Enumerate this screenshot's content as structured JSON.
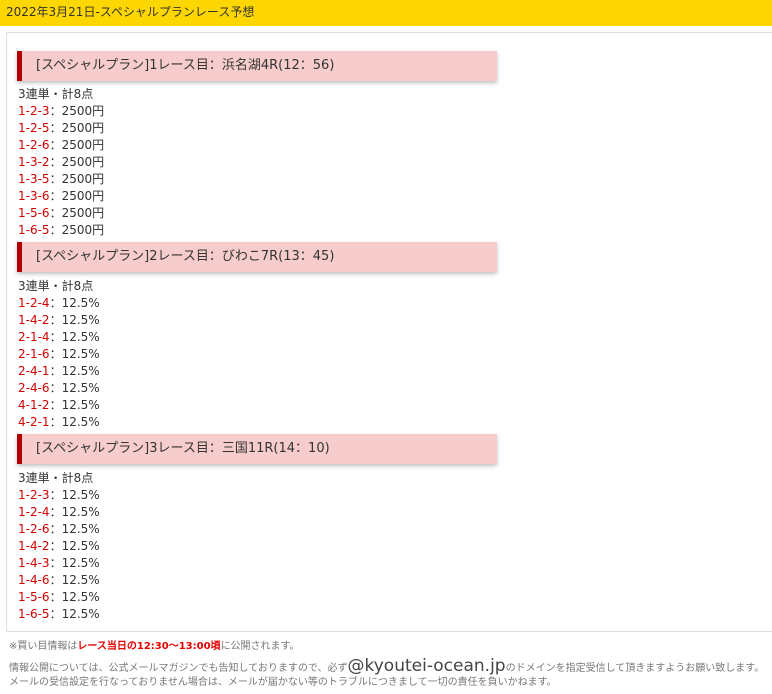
{
  "title": "2022年3月21日-スペシャルプランレース予想",
  "races": [
    {
      "heading": "[スペシャルプラン]1レース目：浜名湖4R(12：56)",
      "summary": "3連単・計8点",
      "bets": [
        {
          "combo": "1-2-3",
          "amount": "：2500円"
        },
        {
          "combo": "1-2-5",
          "amount": "：2500円"
        },
        {
          "combo": "1-2-6",
          "amount": "：2500円"
        },
        {
          "combo": "1-3-2",
          "amount": "：2500円"
        },
        {
          "combo": "1-3-5",
          "amount": "：2500円"
        },
        {
          "combo": "1-3-6",
          "amount": "：2500円"
        },
        {
          "combo": "1-5-6",
          "amount": "：2500円"
        },
        {
          "combo": "1-6-5",
          "amount": "：2500円"
        }
      ]
    },
    {
      "heading": "[スペシャルプラン]2レース目：びわこ7R(13：45)",
      "summary": "3連単・計8点",
      "bets": [
        {
          "combo": "1-2-4",
          "amount": "：12.5%"
        },
        {
          "combo": "1-4-2",
          "amount": "：12.5%"
        },
        {
          "combo": "2-1-4",
          "amount": "：12.5%"
        },
        {
          "combo": "2-1-6",
          "amount": "：12.5%"
        },
        {
          "combo": "2-4-1",
          "amount": "：12.5%"
        },
        {
          "combo": "2-4-6",
          "amount": "：12.5%"
        },
        {
          "combo": "4-1-2",
          "amount": "：12.5%"
        },
        {
          "combo": "4-2-1",
          "amount": "：12.5%"
        }
      ]
    },
    {
      "heading": "[スペシャルプラン]3レース目：三国11R(14：10)",
      "summary": "3連単・計8点",
      "bets": [
        {
          "combo": "1-2-3",
          "amount": "：12.5%"
        },
        {
          "combo": "1-2-4",
          "amount": "：12.5%"
        },
        {
          "combo": "1-2-6",
          "amount": "：12.5%"
        },
        {
          "combo": "1-4-2",
          "amount": "：12.5%"
        },
        {
          "combo": "1-4-3",
          "amount": "：12.5%"
        },
        {
          "combo": "1-4-6",
          "amount": "：12.5%"
        },
        {
          "combo": "1-5-6",
          "amount": "：12.5%"
        },
        {
          "combo": "1-6-5",
          "amount": "：12.5%"
        }
      ]
    }
  ],
  "footer": {
    "note_prefix": "※買い目情報は",
    "note_highlight": "レース当日の12:30〜13:00頃",
    "note_suffix": "に公開されます。",
    "info_prefix": "情報公開については、公式メールマガジンでも告知しておりますので、必ず",
    "domain": "@kyoutei-ocean.jp",
    "info_suffix": "のドメインを指定受信して頂きますようお願い致します。",
    "warning": "メールの受信設定を行なっておりません場合は、メールが届かない等のトラブルにつきまして一切の責任を負いかねます。"
  },
  "colors": {
    "title_bar": "#ffd700",
    "heading_bg": "#f7cccc",
    "heading_border": "#b30000",
    "combo_text": "#d40000",
    "highlight_text": "#e60000"
  }
}
